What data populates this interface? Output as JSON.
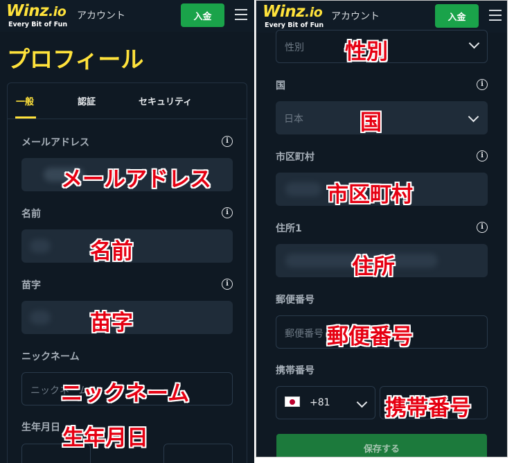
{
  "header": {
    "logo_main": "Winz",
    "logo_suffix": ".io",
    "logo_tagline": "Every Bit of Fun",
    "account_label": "アカウント",
    "deposit_label": "入金"
  },
  "left": {
    "page_title": "プロフィール",
    "tabs": [
      {
        "label": "一般",
        "active": true
      },
      {
        "label": "認証",
        "active": false
      },
      {
        "label": "セキュリティ",
        "active": false
      }
    ],
    "fields": {
      "email_label": "メールアドレス",
      "first_name_label": "名前",
      "last_name_label": "苗字",
      "nickname_label": "ニックネーム",
      "nickname_placeholder": "ニックネーム",
      "birthdate_label": "生年月日"
    },
    "annotations": {
      "email": "メールアドレス",
      "first_name": "名前",
      "last_name": "苗字",
      "nickname": "ニックネーム",
      "birthdate": "生年月日"
    }
  },
  "right": {
    "fields": {
      "gender_placeholder": "性別",
      "country_label": "国",
      "country_value": "日本",
      "city_label": "市区町村",
      "address_label": "住所1",
      "postal_label": "郵便番号",
      "postal_placeholder": "郵便番号",
      "phone_label": "携帯番号",
      "phone_code": "+81"
    },
    "save_label": "保存する",
    "annotations": {
      "gender": "性別",
      "country": "国",
      "city": "市区町村",
      "address": "住所",
      "postal": "郵便番号",
      "phone": "携帯番号"
    }
  },
  "colors": {
    "background": "#0f1923",
    "accent_yellow": "#ffe23b",
    "deposit_green": "#1aa34a",
    "annotation_red": "#e60012"
  },
  "icons": [
    "menu-icon",
    "info-icon",
    "chevron-down-icon",
    "japan-flag-icon"
  ]
}
